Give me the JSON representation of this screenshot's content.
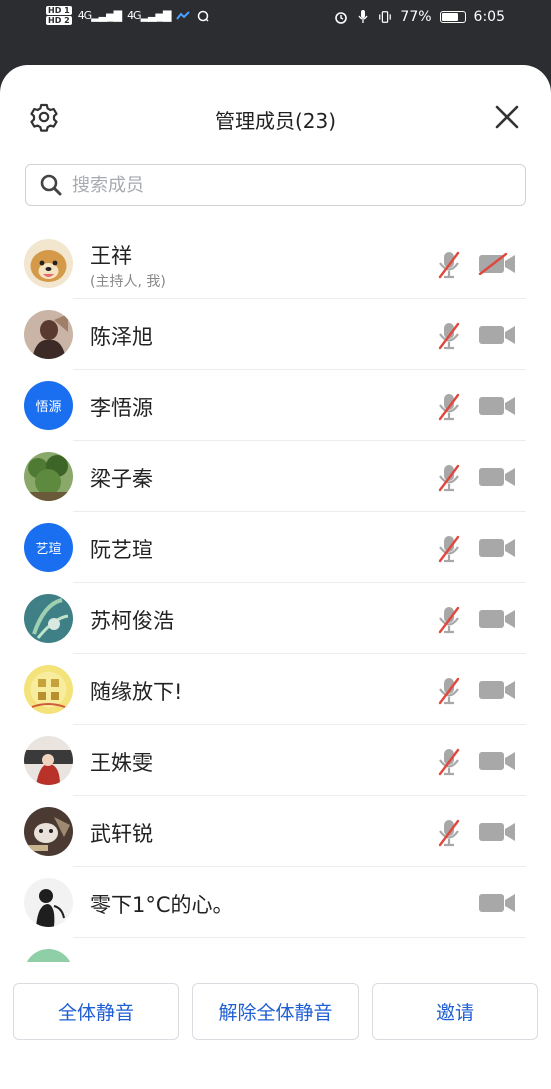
{
  "status_bar": {
    "hd1": "HD 1",
    "hd2": "HD 2",
    "signal1": "4G",
    "signal2": "4G",
    "battery_pct": "77%",
    "battery_level": 0.77,
    "time": "6:05"
  },
  "header": {
    "title": "管理成员(23)",
    "settings_icon": "gear-icon",
    "close_icon": "close-icon"
  },
  "search": {
    "placeholder": "搜索成员",
    "value": ""
  },
  "members": [
    {
      "name": "王祥",
      "subtitle": "(主持人, 我)",
      "avatar_text": "",
      "mic": "muted",
      "video": "off"
    },
    {
      "name": "陈泽旭",
      "avatar_text": "",
      "mic": "muted",
      "video": "on"
    },
    {
      "name": "李悟源",
      "avatar_text": "悟源",
      "mic": "muted",
      "video": "on"
    },
    {
      "name": "梁子秦",
      "avatar_text": "",
      "mic": "muted",
      "video": "on"
    },
    {
      "name": "阮艺瑄",
      "avatar_text": "艺瑄",
      "mic": "muted",
      "video": "on"
    },
    {
      "name": "苏柯俊浩",
      "avatar_text": "",
      "mic": "muted",
      "video": "on"
    },
    {
      "name": "随缘放下!",
      "avatar_text": "",
      "mic": "muted",
      "video": "on"
    },
    {
      "name": "王姝雯",
      "avatar_text": "",
      "mic": "muted",
      "video": "on"
    },
    {
      "name": "武轩锐",
      "avatar_text": "",
      "mic": "muted",
      "video": "on"
    },
    {
      "name": "零下1°C的心。",
      "avatar_text": "",
      "mic": "none",
      "video": "on"
    }
  ],
  "actions": {
    "mute_all": "全体静音",
    "unmute_all": "解除全体静音",
    "invite": "邀请"
  },
  "colors": {
    "accent": "#1f5fd4",
    "avatar_blue": "#1a6ef0",
    "muted_red": "#e0483e",
    "icon_gray": "#9b9b9b"
  }
}
